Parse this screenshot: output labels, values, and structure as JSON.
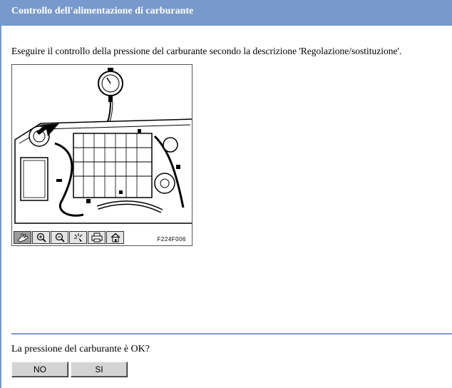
{
  "window": {
    "title": "Controllo dell'alimentazione di carburante"
  },
  "content": {
    "instruction": "Eseguire il controllo della pressione del carburante secondo la descrizione 'Regolazione/sostituzione'.",
    "figure": {
      "code": "F224F006",
      "toolbar": [
        {
          "icon": "hand-pan-icon",
          "active": true
        },
        {
          "icon": "zoom-in-icon"
        },
        {
          "icon": "zoom-out-icon"
        },
        {
          "icon": "highlight-icon"
        },
        {
          "icon": "print-icon"
        },
        {
          "icon": "home-icon"
        }
      ]
    }
  },
  "question": {
    "text": "La pressione del carburante è OK?",
    "no_label": "NO",
    "yes_label": "SI"
  },
  "colors": {
    "title_bar": "#7799cc",
    "title_text": "#ffffff"
  }
}
